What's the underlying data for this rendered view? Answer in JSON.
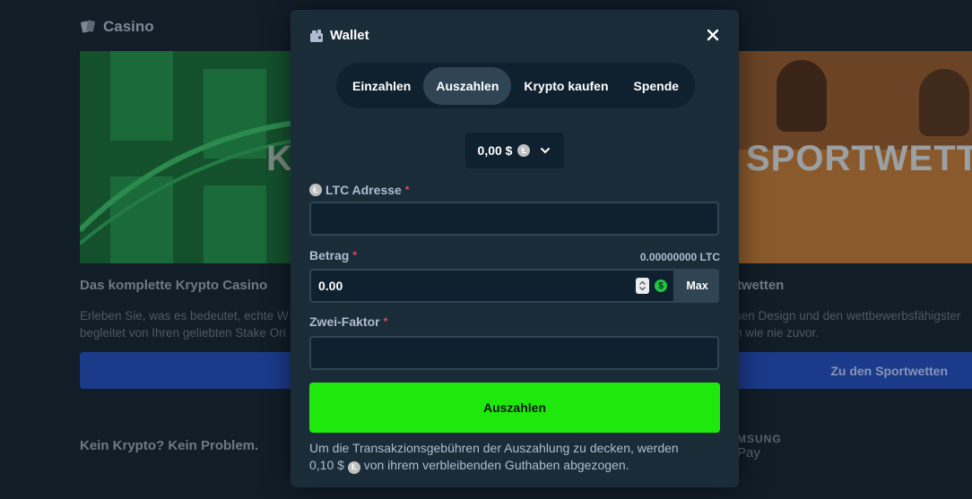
{
  "background": {
    "casino_label": "Casino",
    "card_left_text": "K",
    "card_right_text": "SPORTWETT",
    "title_left": "Das komplette Krypto Casino",
    "title_right": "rtwetten",
    "desc_left_1": "Erleben Sie, was es bedeutet, echte W",
    "desc_left_2": "begleitet von Ihren geliebten Stake Ori",
    "desc_right_1": "sen Design und den wettbewerbsfähigster",
    "desc_right_2": "n wie nie zuvor.",
    "button_right": "Zu den Sportwetten",
    "no_crypto": "Kein Krypto? Kein Problem.",
    "samsung_a": "MSUNG",
    "samsung_b": "Pay"
  },
  "modal": {
    "title": "Wallet",
    "tabs": [
      {
        "label": "Einzahlen",
        "active": false
      },
      {
        "label": "Auszahlen",
        "active": true
      },
      {
        "label": "Krypto kaufen",
        "active": false
      },
      {
        "label": "Spende",
        "active": false
      }
    ],
    "balance": "0,00 $",
    "currency_icon": "Ł",
    "address_label": "LTC Adresse",
    "address_value": "",
    "amount_label": "Betrag",
    "amount_ltc": "0.00000000 LTC",
    "amount_value": "0.00",
    "usd_icon": "$",
    "max_label": "Max",
    "twofa_label": "Zwei-Faktor",
    "twofa_value": "",
    "required_mark": "*",
    "submit_label": "Auszahlen",
    "note_line1": "Um die Transakzionsgebühren der Auszahlung zu decken, werden",
    "note_amount": "0,10 $",
    "note_line2": "von ihrem verbleibenden Guthaben abgezogen."
  },
  "colors": {
    "accent_green": "#1fe80c",
    "panel": "#1a2c38",
    "input_bg": "#0f212e",
    "required": "#ed4163"
  }
}
